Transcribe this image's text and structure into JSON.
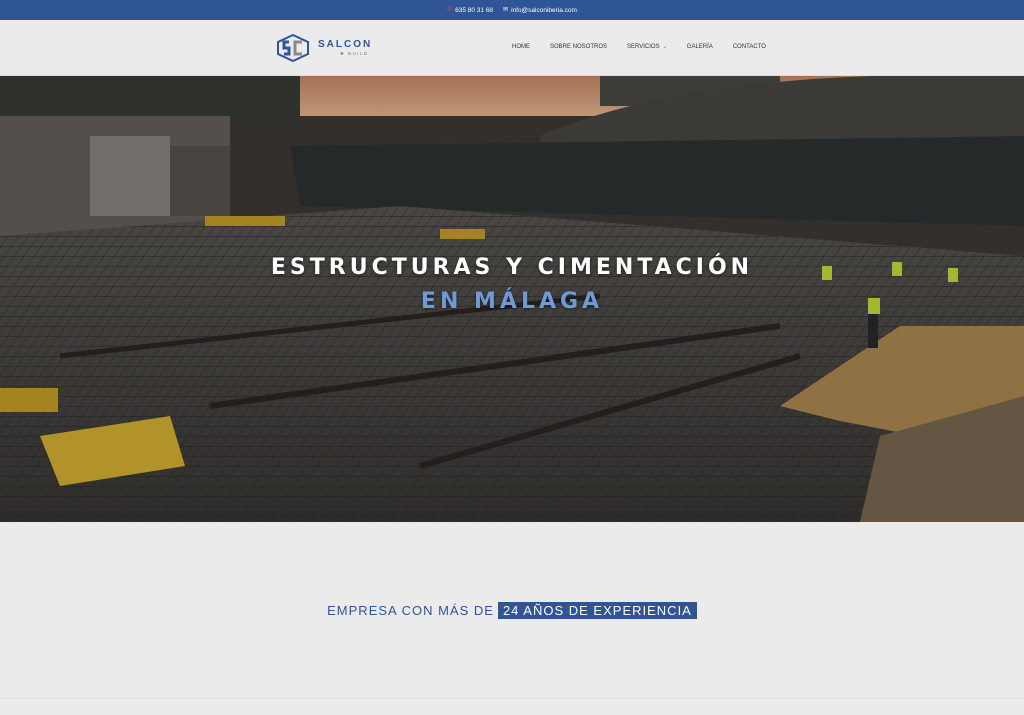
{
  "topbar": {
    "phone": "635 80 31 68",
    "email": "info@salconiberia.com",
    "phone_icon": "phone-icon",
    "email_icon": "envelope-icon"
  },
  "header": {
    "logo_name": "SALCON",
    "logo_sub": "BUILD",
    "nav": {
      "home": "HOME",
      "about": "SOBRE NOSOTROS",
      "services": "SERVICIOS",
      "gallery": "GALERÍA",
      "contact": "CONTACTO"
    }
  },
  "hero": {
    "line1": "ESTRUCTURAS Y CIMENTACIÓN",
    "line2": "EN MÁLAGA"
  },
  "experience": {
    "prefix": "EMPRESA CON MÁS DE",
    "highlight": "24 AÑOS DE EXPERIENCIA"
  },
  "colors": {
    "brand_blue": "#2f5597",
    "hero_accent": "#6f9ad4"
  }
}
